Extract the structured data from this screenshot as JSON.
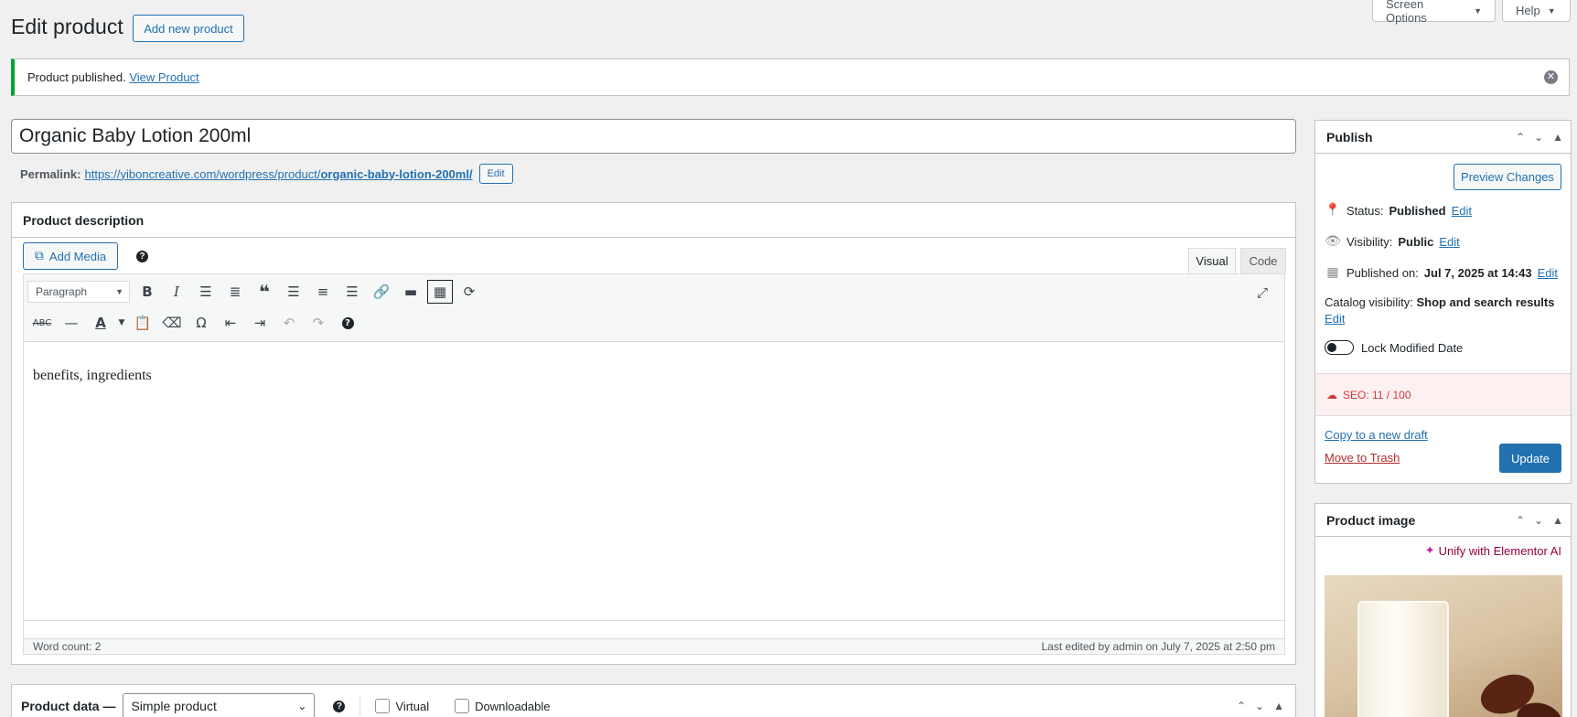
{
  "header": {
    "page_title": "Edit product",
    "add_new_label": "Add new product",
    "screen_options_label": "Screen Options",
    "help_label": "Help"
  },
  "notice": {
    "text": "Product published.",
    "link_text": "View Product"
  },
  "product": {
    "title": "Organic Baby Lotion 200ml",
    "permalink_label": "Permalink:",
    "permalink_base": "https://yiboncreative.com/wordpress/product/",
    "permalink_slug": "organic-baby-lotion-200ml/",
    "permalink_edit_label": "Edit"
  },
  "description": {
    "heading": "Product description",
    "add_media_label": "Add Media",
    "tab_visual": "Visual",
    "tab_code": "Code",
    "format_select": "Paragraph",
    "content": "benefits, ingredients",
    "word_count": "Word count: 2",
    "last_edited": "Last edited by admin on July 7, 2025 at 2:50 pm"
  },
  "product_data": {
    "heading": "Product data —",
    "type_select": "Simple product",
    "virtual_label": "Virtual",
    "downloadable_label": "Downloadable"
  },
  "publish": {
    "heading": "Publish",
    "preview_label": "Preview Changes",
    "status_label": "Status:",
    "status_value": "Published",
    "visibility_label": "Visibility:",
    "visibility_value": "Public",
    "published_on_label": "Published on:",
    "published_on_value": "Jul 7, 2025 at 14:43",
    "catalog_label": "Catalog visibility:",
    "catalog_value": "Shop and search results",
    "edit_label": "Edit",
    "lock_label": "Lock Modified Date",
    "seo_text": "SEO: 11 / 100",
    "copy_draft_label": "Copy to a new draft",
    "trash_label": "Move to Trash",
    "update_label": "Update"
  },
  "product_image": {
    "heading": "Product image",
    "elementor_label": "Unify with Elementor AI"
  },
  "colors": {
    "accent": "#2271b1",
    "success": "#00a32a",
    "danger": "#d63638"
  }
}
